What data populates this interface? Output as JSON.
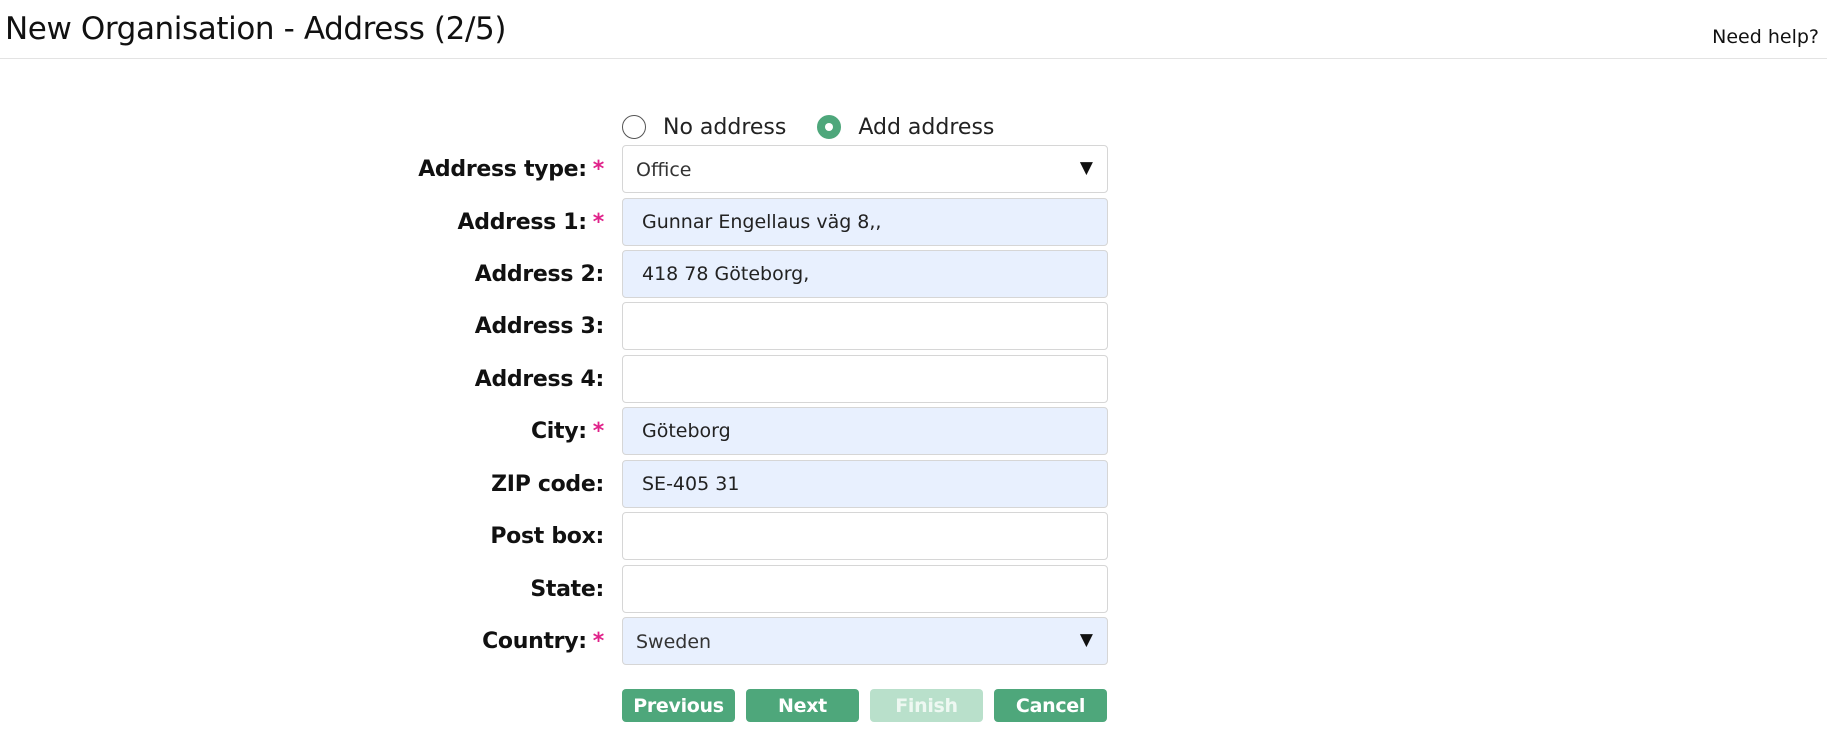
{
  "header": {
    "title": "New Organisation - Address (2/5)",
    "help_label": "Need help?"
  },
  "address_choice": {
    "options": [
      {
        "label": "No address",
        "checked": false
      },
      {
        "label": "Add address",
        "checked": true
      }
    ]
  },
  "form": {
    "address_type": {
      "label": "Address type:",
      "required_mark": "*",
      "value": "Office"
    },
    "address1": {
      "label": "Address 1:",
      "required_mark": "*",
      "value": "Gunnar Engellaus väg 8,,"
    },
    "address2": {
      "label": "Address 2:",
      "value": "418 78 Göteborg,"
    },
    "address3": {
      "label": "Address 3:",
      "value": ""
    },
    "address4": {
      "label": "Address 4:",
      "value": ""
    },
    "city": {
      "label": "City:",
      "required_mark": "*",
      "value": "Göteborg"
    },
    "zip": {
      "label": "ZIP code:",
      "value": "SE-405 31"
    },
    "post_box": {
      "label": "Post box:",
      "value": ""
    },
    "state": {
      "label": "State:",
      "value": ""
    },
    "country": {
      "label": "Country:",
      "required_mark": "*",
      "value": "Sweden"
    }
  },
  "buttons": {
    "previous": "Previous",
    "next": "Next",
    "finish": "Finish",
    "cancel": "Cancel"
  },
  "colors": {
    "accent_green": "#4ea77b",
    "disabled_green": "#b9e0cb",
    "required_mark": "#e0218a",
    "autofill_bg": "#e8f0fe"
  }
}
